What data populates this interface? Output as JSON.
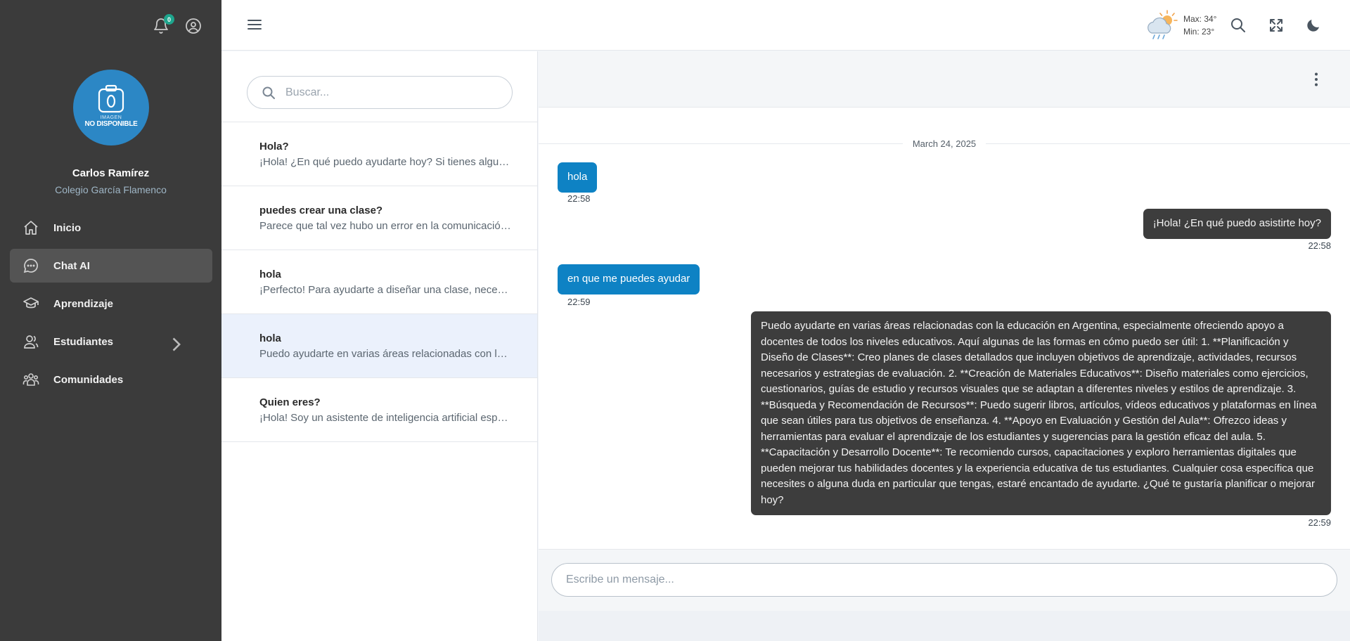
{
  "sidebar": {
    "notification_count": "0",
    "avatar_line1": "IMAGEN",
    "avatar_line2": "NO DISPONIBLE",
    "user_name": "Carlos Ramírez",
    "user_school": "Colegio García Flamenco",
    "items": [
      {
        "label": "Inicio",
        "icon": "home-icon"
      },
      {
        "label": "Chat AI",
        "icon": "chat-icon",
        "active": true
      },
      {
        "label": "Aprendizaje",
        "icon": "graduation-cap-icon"
      },
      {
        "label": "Estudiantes",
        "icon": "users-icon",
        "has_submenu": true
      },
      {
        "label": "Comunidades",
        "icon": "community-icon"
      }
    ]
  },
  "header": {
    "weather_max": "Max: 34°",
    "weather_min": "Min: 23°"
  },
  "conversations": {
    "search_placeholder": "Buscar...",
    "items": [
      {
        "title": "Hola?",
        "preview": "¡Hola! ¿En qué puedo ayudarte hoy? Si tienes alguna pregunta o necesitas ayuda con algo, no dudes en decírmelo."
      },
      {
        "title": "puedes crear una clase?",
        "preview": "Parece que tal vez hubo un error en la comunicación. ¿Podrías darme más detalles?"
      },
      {
        "title": "hola",
        "preview": "¡Perfecto! Para ayudarte a diseñar una clase, necesito algunos detalles más."
      },
      {
        "title": "hola",
        "preview": "Puedo ayudarte en varias áreas relacionadas con la educación en Argentina",
        "active": true
      },
      {
        "title": "Quien eres?",
        "preview": "¡Hola! Soy un asistente de inteligencia artificial especializado en educación."
      }
    ]
  },
  "chat": {
    "date": "March 24, 2025",
    "messages": [
      {
        "from": "user",
        "text": "hola",
        "time": "22:58"
      },
      {
        "from": "bot",
        "text": "¡Hola! ¿En qué puedo asistirte hoy?",
        "time": "22:58"
      },
      {
        "from": "user",
        "text": "en que me puedes ayudar",
        "time": "22:59"
      },
      {
        "from": "bot",
        "text": "Puedo ayudarte en varias áreas relacionadas con la educación en Argentina, especialmente ofreciendo apoyo a docentes de todos los niveles educativos. Aquí algunas de las formas en cómo puedo ser útil: 1. **Planificación y Diseño de Clases**: Creo planes de clases detallados que incluyen objetivos de aprendizaje, actividades, recursos necesarios y estrategias de evaluación. 2. **Creación de Materiales Educativos**: Diseño materiales como ejercicios, cuestionarios, guías de estudio y recursos visuales que se adaptan a diferentes niveles y estilos de aprendizaje. 3. **Búsqueda y Recomendación de Recursos**: Puedo sugerir libros, artículos, vídeos educativos y plataformas en línea que sean útiles para tus objetivos de enseñanza. 4. **Apoyo en Evaluación y Gestión del Aula**: Ofrezco ideas y herramientas para evaluar el aprendizaje de los estudiantes y sugerencias para la gestión eficaz del aula. 5. **Capacitación y Desarrollo Docente**: Te recomiendo cursos, capacitaciones y exploro herramientas digitales que pueden mejorar tus habilidades docentes y la experiencia educativa de tus estudiantes. Cualquier cosa específica que necesites o alguna duda en particular que tengas, estaré encantado de ayudarte. ¿Qué te gustaría planificar o mejorar hoy?",
        "time": "22:59"
      }
    ],
    "input_placeholder": "Escribe un mensaje..."
  }
}
